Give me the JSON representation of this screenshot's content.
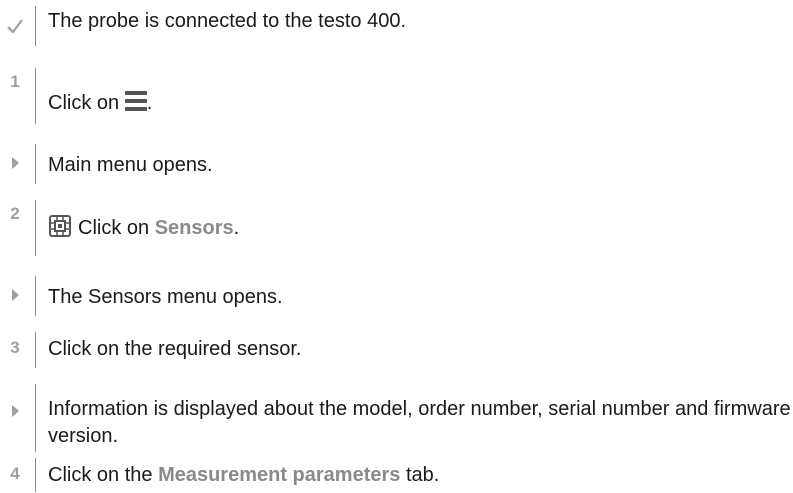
{
  "steps": [
    {
      "marker": "check",
      "text": "The probe is connected to the testo 400."
    },
    {
      "marker": "1",
      "prefix": "Click on ",
      "icon": "hamburger-menu-icon",
      "suffix": "."
    },
    {
      "marker": "arrow",
      "text": "Main menu opens."
    },
    {
      "marker": "2",
      "icon": "sensor-chip-icon",
      "prefix": "Click on ",
      "highlight": "Sensors",
      "suffix": "."
    },
    {
      "marker": "arrow",
      "text": "The Sensors menu opens."
    },
    {
      "marker": "3",
      "text": "Click on the required sensor."
    },
    {
      "marker": "arrow",
      "text": "Information is displayed about the model, order number, serial number and firmware version."
    },
    {
      "marker": "4",
      "prefix": "Click on the ",
      "highlight": "Measurement parameters",
      "suffix": " tab."
    }
  ],
  "colors": {
    "text": "#1a1a1a",
    "highlight": "#8a8a8a",
    "marker": "#9aa0a6",
    "icon": "#555555"
  }
}
